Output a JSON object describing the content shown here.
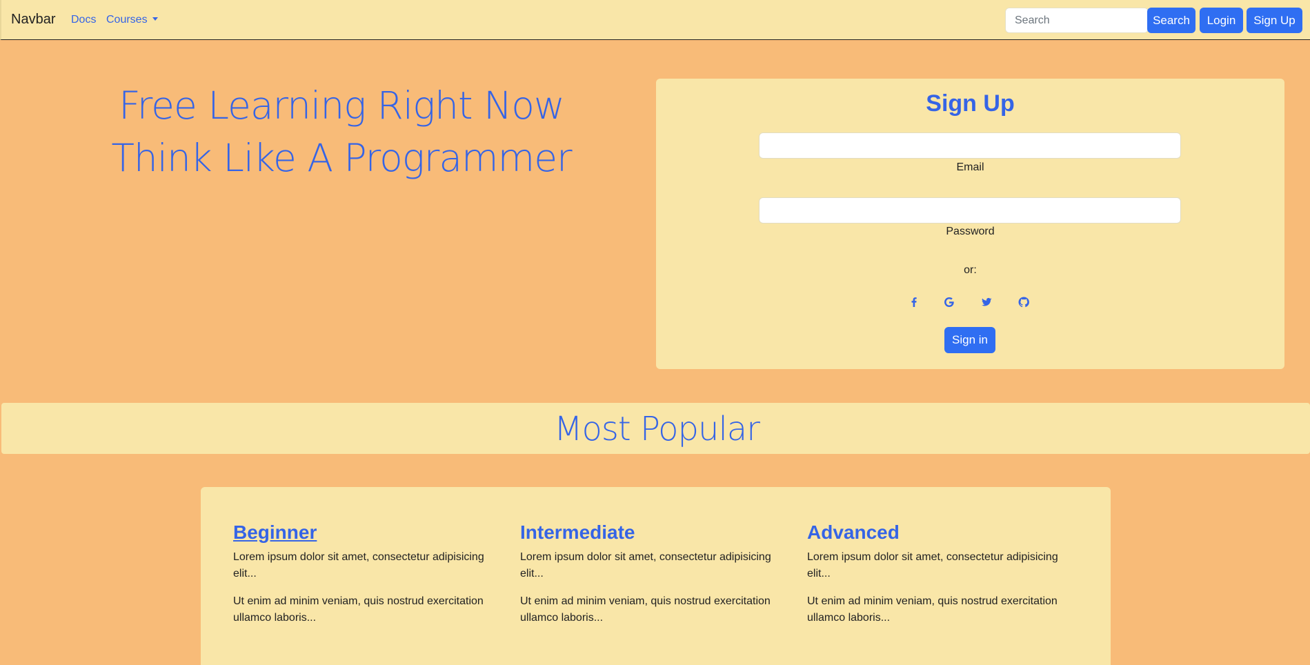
{
  "navbar": {
    "brand": "Navbar",
    "links": {
      "docs": "Docs",
      "courses": "Courses"
    },
    "search": {
      "placeholder": "Search",
      "value": ""
    },
    "search_button": "Search",
    "login_button": "Login",
    "signup_button": "Sign Up"
  },
  "hero": {
    "line1": "Free Learning Right Now",
    "line2": "Think Like A Programmer"
  },
  "signup_form": {
    "title": "Sign Up",
    "email_label": "Email",
    "email_value": "",
    "password_label": "Password",
    "password_value": "",
    "or_text": "or:",
    "social_icons": [
      "facebook-icon",
      "google-icon",
      "twitter-icon",
      "github-icon"
    ],
    "submit_label": "Sign in"
  },
  "popular": {
    "title": "Most Popular",
    "courses": [
      {
        "title": "Beginner",
        "text1": "Lorem ipsum dolor sit amet, consectetur adipisicing elit...",
        "text2": "Ut enim ad minim veniam, quis nostrud exercitation ullamco laboris..."
      },
      {
        "title": "Intermediate",
        "text1": "Lorem ipsum dolor sit amet, consectetur adipisicing elit...",
        "text2": "Ut enim ad minim veniam, quis nostrud exercitation ullamco laboris..."
      },
      {
        "title": "Advanced",
        "text1": "Lorem ipsum dolor sit amet, consectetur adipisicing elit...",
        "text2": "Ut enim ad minim veniam, quis nostrud exercitation ullamco laboris..."
      }
    ]
  },
  "colors": {
    "page_background": "#f8bb78",
    "panel_background": "#f9e6a8",
    "accent_blue": "#3564e6",
    "button_blue": "#2f6ef2"
  }
}
